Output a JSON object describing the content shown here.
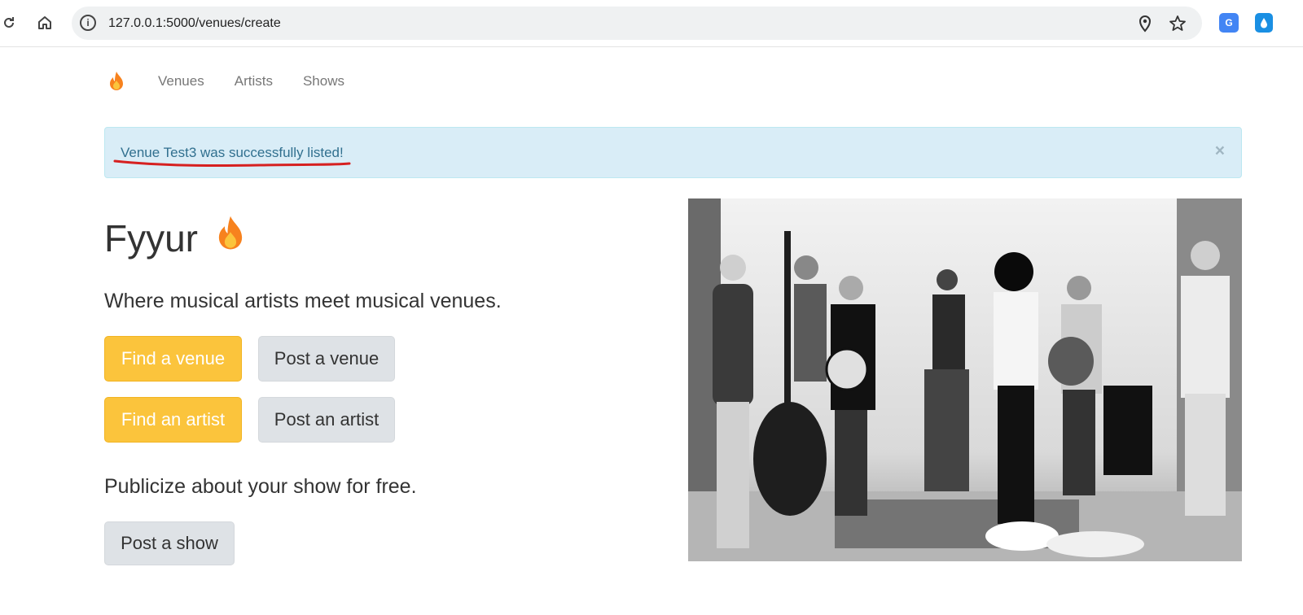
{
  "browser": {
    "url": "127.0.0.1:5000/venues/create",
    "icons": [
      "reload-icon",
      "home-icon",
      "site-info-icon",
      "location-icon",
      "bookmark-star-icon",
      "google-translate-icon",
      "extension-drop-icon"
    ]
  },
  "nav": {
    "brand_icon": "flame-icon",
    "items": [
      {
        "label": "Venues"
      },
      {
        "label": "Artists"
      },
      {
        "label": "Shows"
      }
    ]
  },
  "alert": {
    "message": "Venue Test3 was successfully listed!",
    "close_label": "×",
    "bg_color": "#d9edf7",
    "text_color": "#31708f",
    "annotation_color": "#d62020"
  },
  "hero": {
    "title": "Fyyur",
    "tagline": "Where musical artists meet musical venues.",
    "buttons": {
      "find_venue": "Find a venue",
      "post_venue": "Post a venue",
      "find_artist": "Find an artist",
      "post_artist": "Post an artist"
    },
    "publicize": "Publicize about your show for free.",
    "post_show": "Post a show"
  },
  "colors": {
    "warning": "#fbc43c",
    "default_button": "#dee2e6",
    "flame_outer": "#f7821e",
    "flame_inner": "#fbc43c"
  }
}
